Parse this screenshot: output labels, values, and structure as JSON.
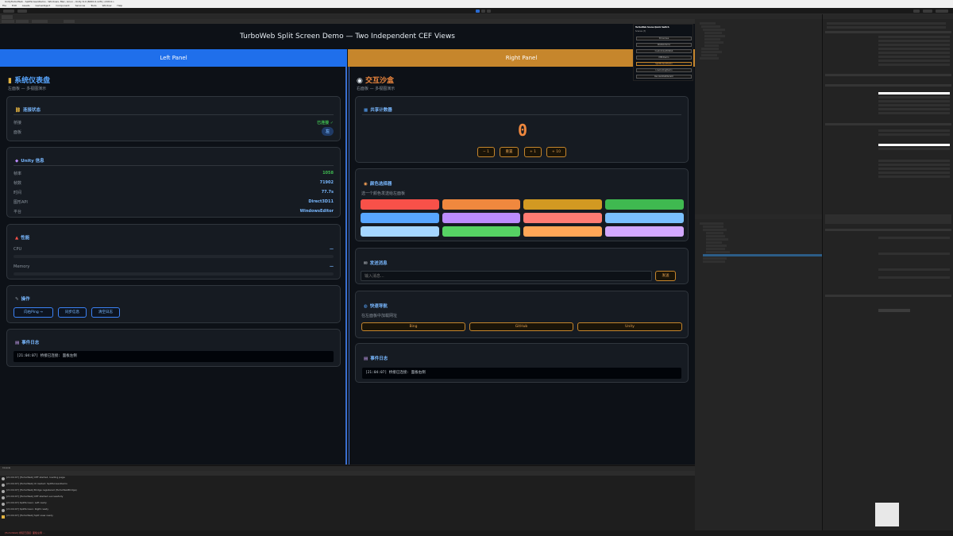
{
  "window": {
    "title": "UnityTurboWeb - SplitScreenDemo - Windows, Mac, Linux - Unity 6.0 (6000.0.xxf1) <DX11>"
  },
  "menu": [
    "File",
    "Edit",
    "Assets",
    "GameObject",
    "Component",
    "Services",
    "Tools",
    "Window",
    "Help"
  ],
  "game": {
    "title": "TurboWeb Split Screen Demo — Two Independent CEF Views",
    "left_header": "Left Panel",
    "right_header": "Right Panel"
  },
  "left": {
    "title": "系统仪表盘",
    "title_icon": "chart-icon",
    "subtitle": "左面板 — 多视图演示",
    "connection": {
      "title": "连接状态",
      "rows": [
        {
          "label": "桥接",
          "value": "已连接 ✓"
        },
        {
          "label": "面板",
          "value": "左"
        }
      ]
    },
    "unity": {
      "title": "Unity 信息",
      "rows": [
        {
          "label": "帧率",
          "value": "1058"
        },
        {
          "label": "帧数",
          "value": "71902"
        },
        {
          "label": "时间",
          "value": "77.7s"
        },
        {
          "label": "图形API",
          "value": "Direct3D11"
        },
        {
          "label": "平台",
          "value": "WindowsEditor"
        }
      ]
    },
    "perf": {
      "title": "性能",
      "cpu_label": "CPU",
      "cpu_value": "—",
      "mem_label": "Memory",
      "mem_value": "—"
    },
    "actions": {
      "title": "操作",
      "buttons": [
        "向右Ping →",
        "同步信息",
        "清空日志"
      ]
    },
    "log": {
      "title": "事件日志",
      "line": "[21:04:07] 桥接已连接: 面板左侧"
    }
  },
  "right": {
    "title": "交互沙盒",
    "subtitle": "右面板 — 多视图演示",
    "counter": {
      "title": "共享计数器",
      "value": "0",
      "buttons": [
        "− 1",
        "重置",
        "+ 1",
        "+ 10"
      ]
    },
    "colors": {
      "title": "颜色选择器",
      "subtitle": "选一个颜色发送给左面板",
      "swatches": [
        "#f85149",
        "#f0883e",
        "#d29922",
        "#3fb950",
        "#58a6ff",
        "#bc8cff",
        "#ff7b72",
        "#79c0ff",
        "#a5d6ff",
        "#56d364",
        "#ffa657",
        "#d2a8ff"
      ]
    },
    "message": {
      "title": "发送消息",
      "placeholder": "输入消息...",
      "send": "发送"
    },
    "nav": {
      "title": "快速导航",
      "subtitle": "在左面板中加载网址",
      "buttons": [
        "Bing",
        "GitHub",
        "Unity"
      ]
    },
    "log": {
      "title": "事件日志",
      "line": "[21:04:07] 桥接已连接: 面板右侧"
    }
  },
  "quick_switch": {
    "title": "TurboWeb Scene Quick Switch",
    "subtitle": "Scenes (7)",
    "items": [
      "Showcase",
      "WebGLDemo",
      "CustomizedUIWeb",
      "MECDemo",
      "SplitScreenDemo",
      "LiveCodingDemo",
      "RenderWebMadeUI"
    ]
  },
  "console": {
    "tab": "Console",
    "rows": [
      "[21:04:07] [TurboWeb] CEF started, loading page",
      "[21:04:07] [TurboWeb] UI loaded: SplitScreenDemo",
      "[21:04:07] [TurboWeb] Bridge registered (TurboWebBridge)",
      "[21:04:07] [TurboWeb] CEF started successfully",
      "[21:04:07] SplitScreen: Left ready",
      "[21:04:07] SplitScreen: Right ready",
      "[21:04:07] [TurboWeb] Split view ready"
    ]
  },
  "status": "[TurboWeb] 桥接已连接: 面板左侧 ..."
}
